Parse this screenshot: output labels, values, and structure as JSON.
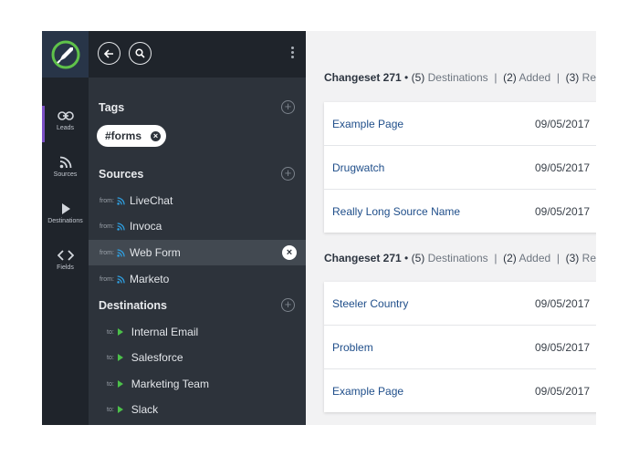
{
  "rail": {
    "items": [
      {
        "label": "Leads",
        "icon": "link-icon",
        "active": true
      },
      {
        "label": "Sources",
        "icon": "rss-icon",
        "active": false
      },
      {
        "label": "Destinations",
        "icon": "play-icon",
        "active": false
      },
      {
        "label": "Fields",
        "icon": "code-icon",
        "active": false
      }
    ]
  },
  "panel": {
    "tags_title": "Tags",
    "tag_chip": "#forms",
    "sources_title": "Sources",
    "from_label": "from:",
    "sources": [
      "LiveChat",
      "Invoca",
      "Web Form",
      "Marketo"
    ],
    "selected_source": "Web Form",
    "destinations_title": "Destinations",
    "to_label": "to:",
    "destinations": [
      "Internal Email",
      "Salesforce",
      "Marketing Team",
      "Slack"
    ]
  },
  "changesets": [
    {
      "title": "Changeset 271",
      "bullet": "•",
      "destinations_count": "(5)",
      "destinations_label": "Destinations",
      "sep": "|",
      "added_count": "(2)",
      "added_label": "Added",
      "removed_count": "(3)",
      "removed_label": "Removed",
      "rows": [
        {
          "title": "Example Page",
          "date": "09/05/2017"
        },
        {
          "title": "Drugwatch",
          "date": "09/05/2017"
        },
        {
          "title": "Really Long Source Name",
          "date": "09/05/2017"
        }
      ]
    },
    {
      "title": "Changeset 271",
      "bullet": "•",
      "destinations_count": "(5)",
      "destinations_label": "Destinations",
      "sep": "|",
      "added_count": "(2)",
      "added_label": "Added",
      "removed_count": "(3)",
      "removed_label": "Removed",
      "rows": [
        {
          "title": "Steeler Country",
          "date": "09/05/2017"
        },
        {
          "title": "Problem",
          "date": "09/05/2017"
        },
        {
          "title": "Example Page",
          "date": "09/05/2017"
        }
      ]
    }
  ],
  "colors": {
    "accent": "#7a4fc4",
    "play": "#4cc04a",
    "link": "#1f4e8a",
    "rss": "#2f9fe0"
  }
}
